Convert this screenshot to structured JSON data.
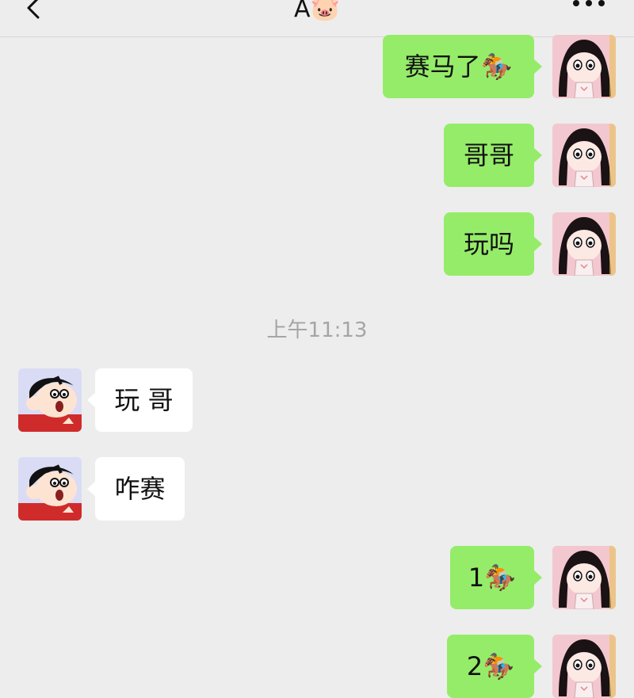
{
  "header": {
    "title": "A🐷",
    "back_icon": "chevron-left-icon",
    "more_icon": "more-dots-icon"
  },
  "timestamp": "上午11:13",
  "messages": [
    {
      "side": "out",
      "text": "赛马了🏇"
    },
    {
      "side": "out",
      "text": "哥哥"
    },
    {
      "side": "out",
      "text": "玩吗"
    },
    {
      "side": "in",
      "text": "玩 哥"
    },
    {
      "side": "in",
      "text": "咋赛"
    },
    {
      "side": "out",
      "text": "1🏇"
    },
    {
      "side": "out",
      "text": "2🏇"
    }
  ],
  "colors": {
    "background": "#ededed",
    "outgoing_bubble": "#95ec69",
    "incoming_bubble": "#ffffff",
    "timestamp_text": "#a5a5a5"
  }
}
